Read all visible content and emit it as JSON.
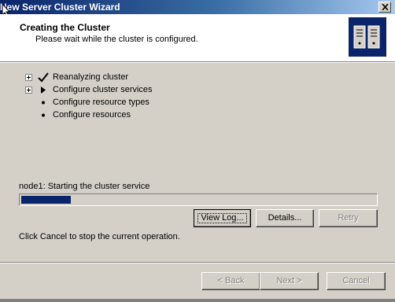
{
  "window": {
    "title": "New Server Cluster Wizard"
  },
  "header": {
    "title": "Creating the Cluster",
    "subtitle": "Please wait while the cluster is configured."
  },
  "tasks": [
    {
      "label": "Reanalyzing cluster",
      "expandable": true,
      "status": "check-icon"
    },
    {
      "label": "Configure cluster services",
      "expandable": true,
      "status": "arrow-icon"
    },
    {
      "label": "Configure resource types",
      "expandable": false,
      "status": "bullet-icon"
    },
    {
      "label": "Configure resources",
      "expandable": false,
      "status": "bullet-icon"
    }
  ],
  "status_text": "node1: Starting the cluster service",
  "progress": {
    "percent": 14
  },
  "buttons": {
    "view_log": "View Log...",
    "details": "Details...",
    "retry": "Retry"
  },
  "hint": "Click Cancel to stop the current operation.",
  "nav": {
    "back": "< Back",
    "next": "Next >",
    "cancel": "Cancel"
  },
  "colors": {
    "titlebar": "#0a246a",
    "progress_fill": "#0a246a",
    "face": "#d4d0c8"
  }
}
